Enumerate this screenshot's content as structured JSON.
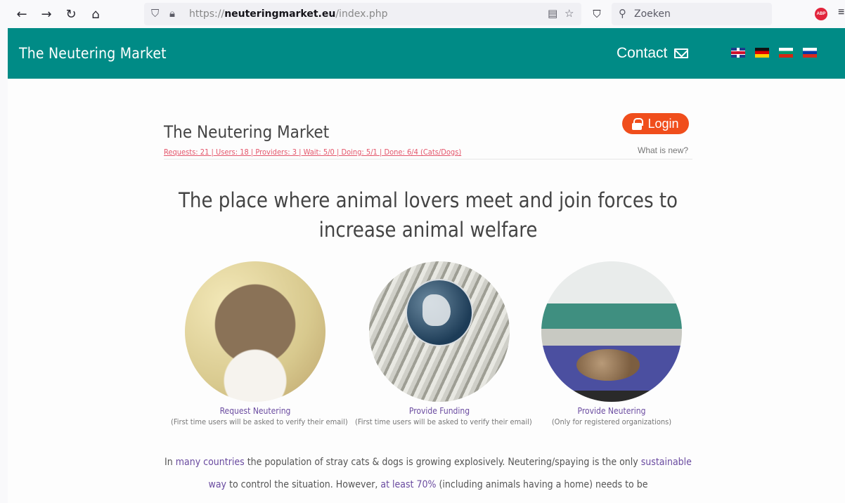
{
  "browser": {
    "url_prefix": "https://",
    "url_domain": "neuteringmarket.eu",
    "url_path": "/index.php",
    "search_placeholder": "Zoeken",
    "extension_badge": "ABP"
  },
  "header": {
    "brand": "The Neutering Market",
    "contact_label": "Contact",
    "languages": [
      "English",
      "Deutsch",
      "Български",
      "Русский"
    ]
  },
  "main": {
    "site_title": "The Neutering Market",
    "stats": "Requests: 21 | Users: 18 | Providers: 3 | Wait: 5/0 | Doing: 5/1 | Done: 6/4 (Cats/Dogs)",
    "login_label": "Login",
    "whats_new": "What is new?",
    "headline": "The place where animal lovers meet and join forces to increase animal welfare",
    "cards": [
      {
        "title": "Request Neutering",
        "note": "(First time users will be asked to verify their email)"
      },
      {
        "title": "Provide Funding",
        "note": "(First time users will be asked to verify their email)"
      },
      {
        "title": "Provide Neutering",
        "note": "(Only for registered organizations)"
      }
    ],
    "paragraph": {
      "p1": "In ",
      "link1": "many countries",
      "p2": " the population of stray cats & dogs is growing explosively. Neutering/spaying is the only ",
      "link2": "sustainable way",
      "p3": " to control the situation. However, ",
      "link3": "at least 70%",
      "p4": " (including animals having a home) needs to be"
    }
  },
  "colors": {
    "header_bg": "#008b86",
    "login_bg": "#f04e1c",
    "stats_link": "#e4566b",
    "link": "#6a4ba0"
  }
}
